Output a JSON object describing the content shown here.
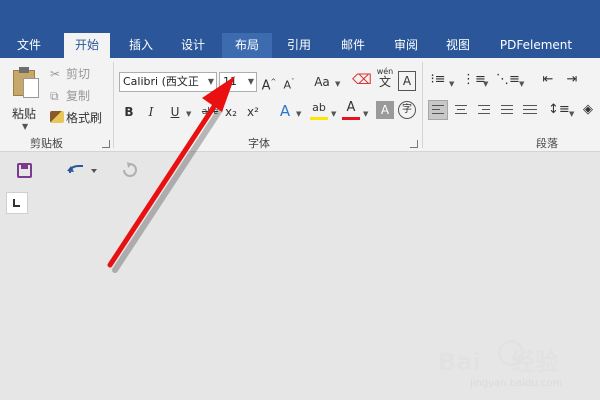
{
  "tabs": [
    {
      "key": "file",
      "label": "文件"
    },
    {
      "key": "home",
      "label": "开始"
    },
    {
      "key": "insert",
      "label": "插入"
    },
    {
      "key": "design",
      "label": "设计"
    },
    {
      "key": "layout",
      "label": "布局"
    },
    {
      "key": "references",
      "label": "引用"
    },
    {
      "key": "mailings",
      "label": "邮件"
    },
    {
      "key": "review",
      "label": "审阅"
    },
    {
      "key": "view",
      "label": "视图"
    },
    {
      "key": "pdfelement",
      "label": "PDFelement"
    }
  ],
  "clipboard": {
    "paste_label": "粘贴",
    "cut_label": "剪切",
    "copy_label": "复制",
    "format_painter_label": "格式刷",
    "group_label": "剪贴板"
  },
  "font": {
    "font_name": "Calibri (西文正",
    "font_size": "11",
    "grow_glyph": "A",
    "shrink_glyph": "A",
    "case_glyph": "Aa",
    "phonetic_top": "wén",
    "phonetic_bottom": "文",
    "border_glyph": "A",
    "bold_glyph": "B",
    "italic_glyph": "I",
    "underline_glyph": "U",
    "strike_glyph": "abc",
    "subscript_glyph": "x₂",
    "superscript_glyph": "x²",
    "effects_glyph": "A",
    "highlight_glyph": "ab",
    "color_glyph": "A",
    "shade_glyph": "A",
    "enclose_glyph": "字",
    "group_label": "字体"
  },
  "paragraph": {
    "group_label": "段落"
  },
  "colors": {
    "accent": "#2b579a",
    "highlight": "#ffe600",
    "font_color": "#e81123",
    "arrow": "#e81010"
  },
  "icons": {
    "save": "save-icon",
    "undo": "undo-icon",
    "redo": "redo-icon"
  },
  "watermark": {
    "brand": "Bai",
    "brand_suffix": "经验",
    "url": "jingyan.baidu.com"
  }
}
